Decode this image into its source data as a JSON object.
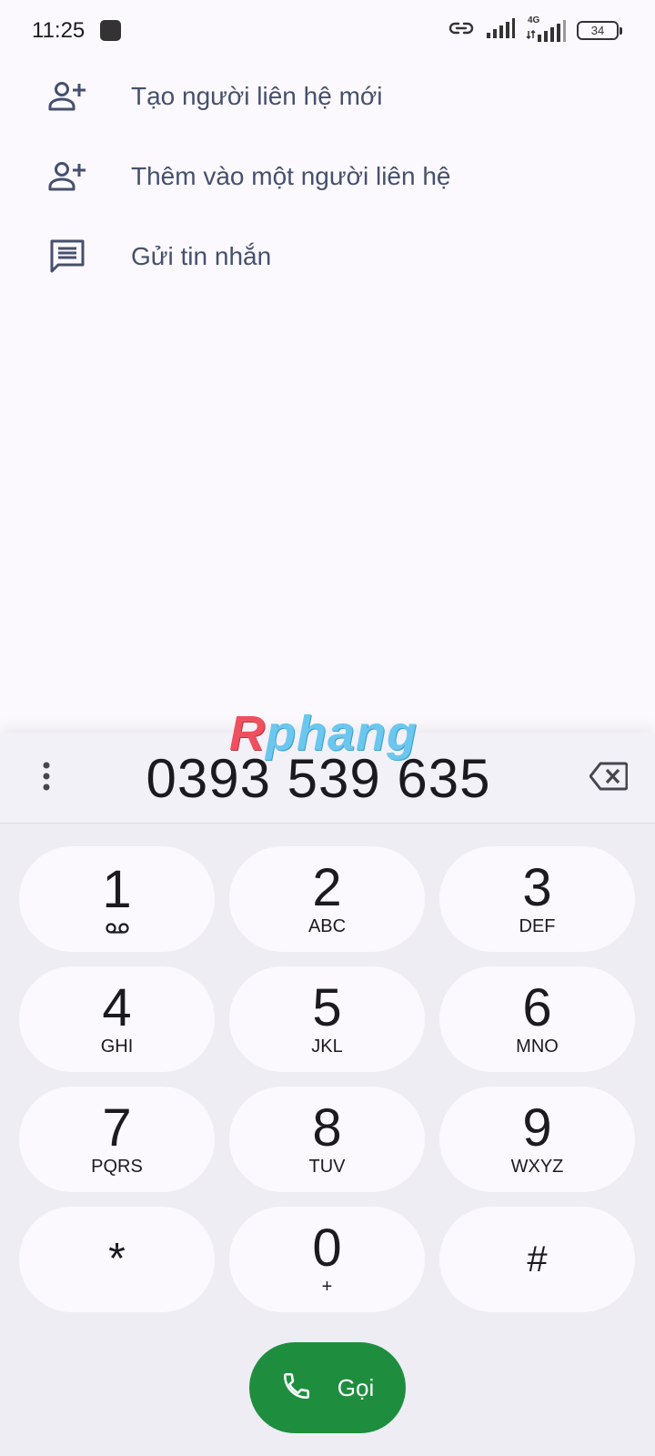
{
  "status_bar": {
    "time": "11:25",
    "network_type": "4G",
    "battery": "34"
  },
  "suggestions": [
    {
      "label": "Tạo người liên hệ mới",
      "icon": "add-person-icon"
    },
    {
      "label": "Thêm vào một người liên hệ",
      "icon": "add-person-icon"
    },
    {
      "label": "Gửi tin nhắn",
      "icon": "message-icon"
    }
  ],
  "watermark": {
    "first": "R",
    "rest": "phang"
  },
  "dialer": {
    "number": "0393 539 635",
    "keys": [
      {
        "digit": "1",
        "letters": ""
      },
      {
        "digit": "2",
        "letters": "ABC"
      },
      {
        "digit": "3",
        "letters": "DEF"
      },
      {
        "digit": "4",
        "letters": "GHI"
      },
      {
        "digit": "5",
        "letters": "JKL"
      },
      {
        "digit": "6",
        "letters": "MNO"
      },
      {
        "digit": "7",
        "letters": "PQRS"
      },
      {
        "digit": "8",
        "letters": "TUV"
      },
      {
        "digit": "9",
        "letters": "WXYZ"
      },
      {
        "digit": "*",
        "letters": ""
      },
      {
        "digit": "0",
        "letters": "+"
      },
      {
        "digit": "#",
        "letters": ""
      }
    ],
    "call_label": "Gọi"
  },
  "colors": {
    "accent_green": "#1e8e3e",
    "icon_color": "#45506e"
  }
}
